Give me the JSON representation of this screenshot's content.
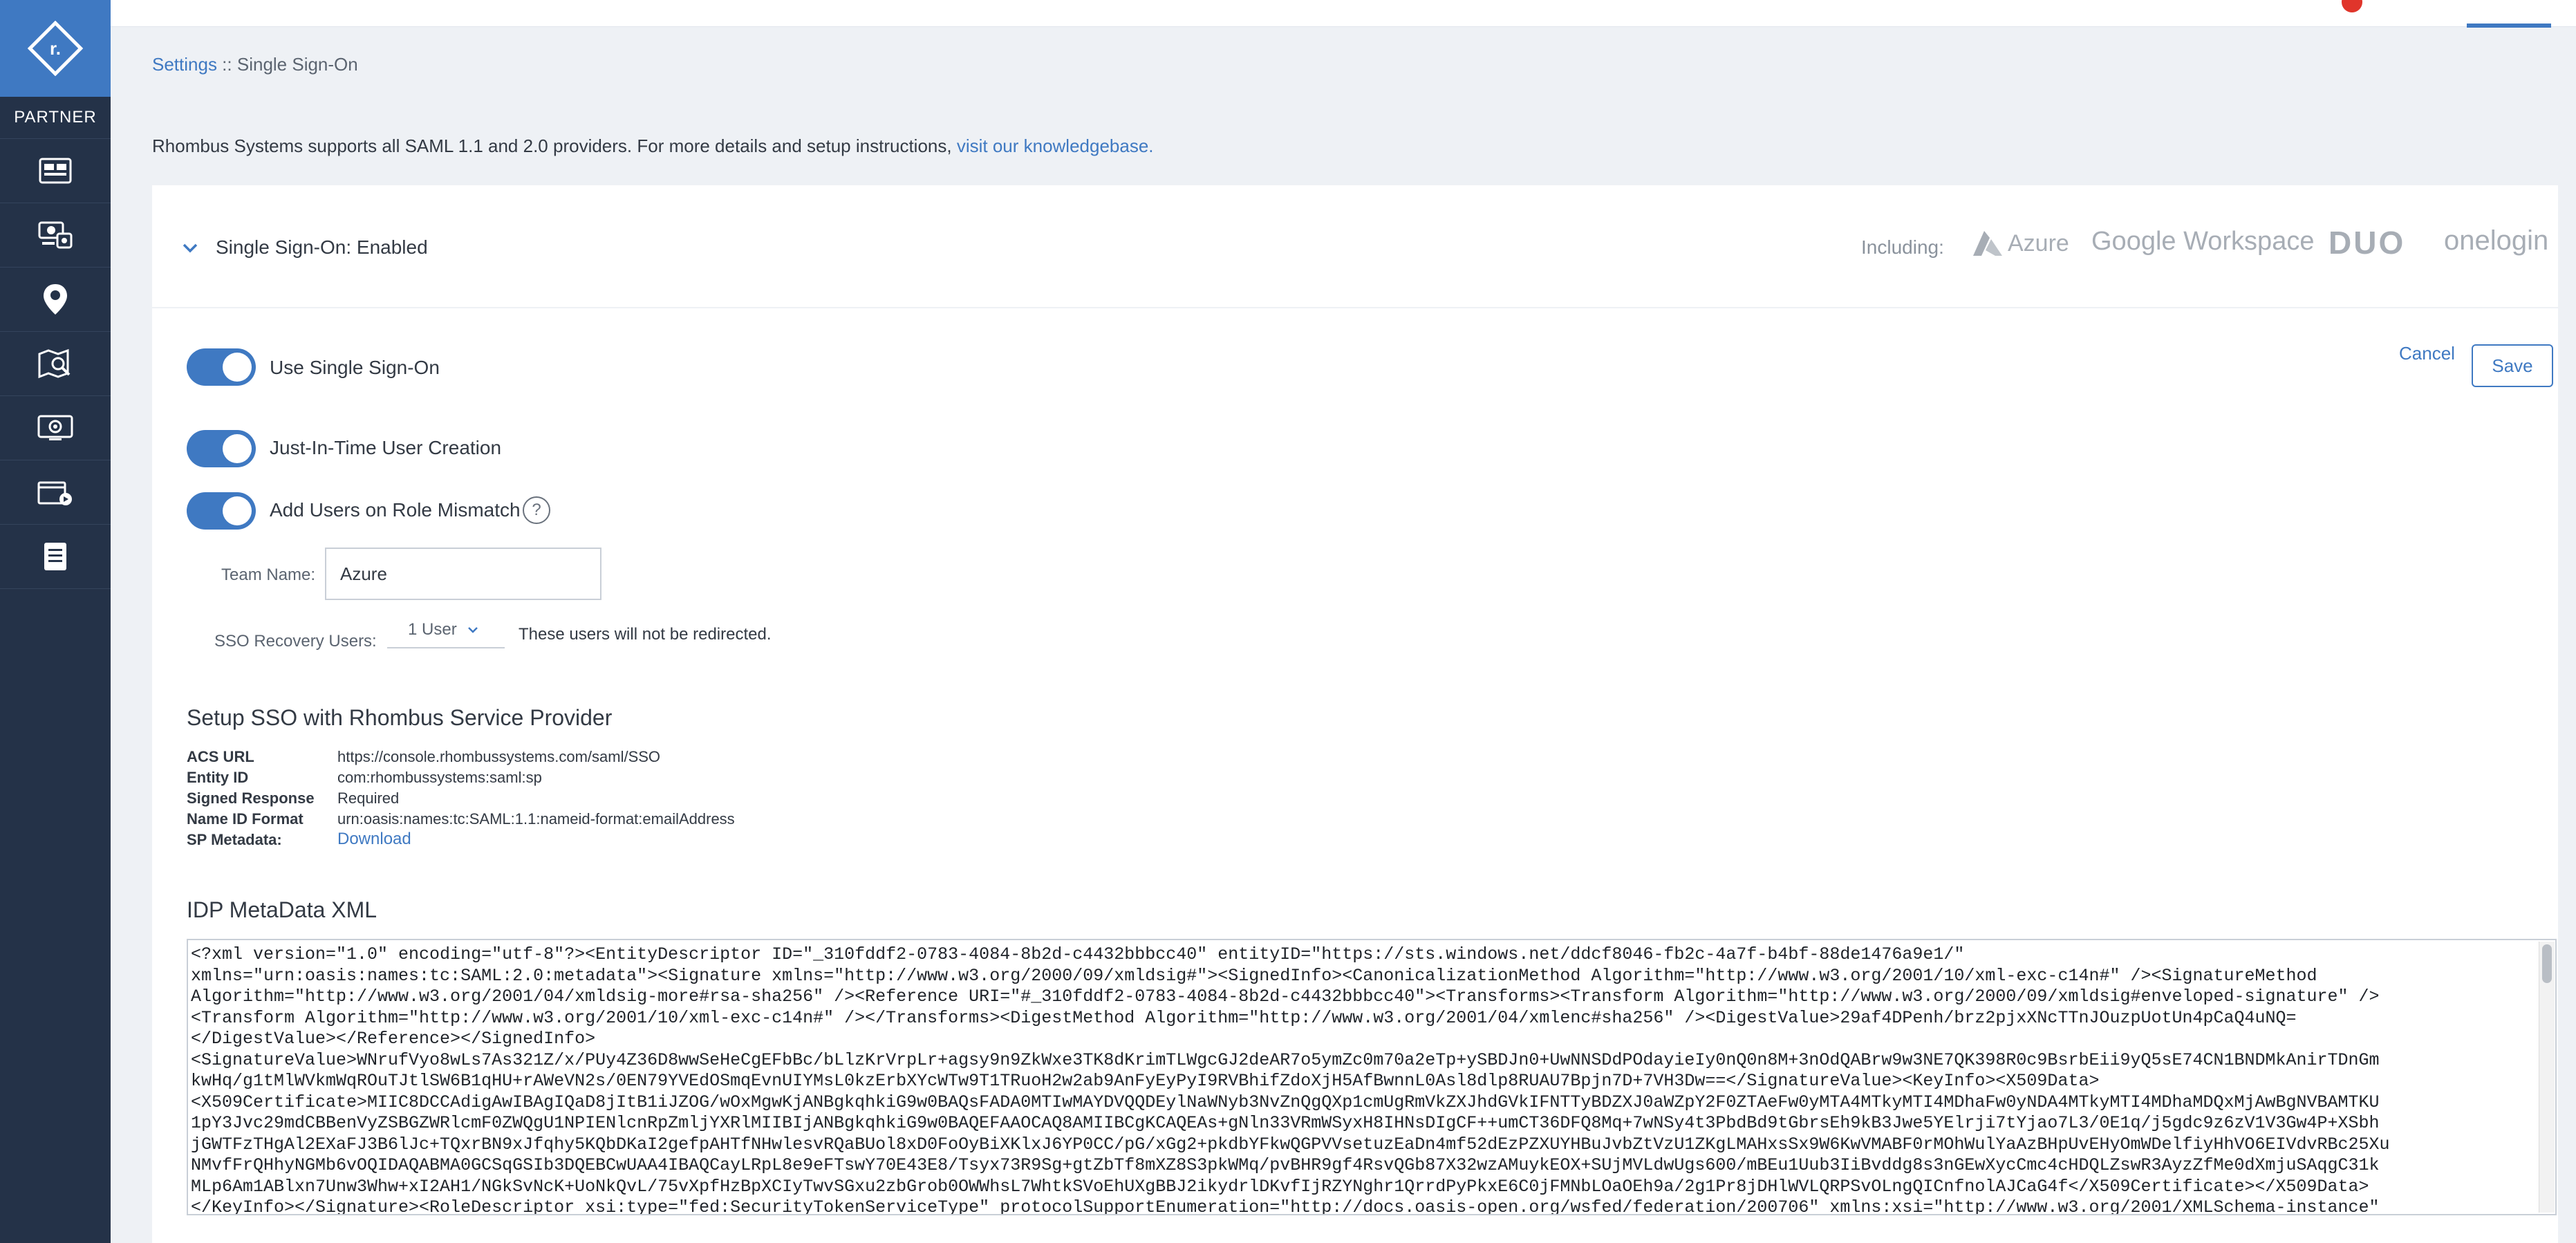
{
  "sidebar": {
    "logo_letter": "r.",
    "partner_label": "PARTNER",
    "nav_icons": [
      "dashboard-icon",
      "devices-icon",
      "location-pin-icon",
      "map-search-icon",
      "camera-device-icon",
      "video-clips-icon",
      "reports-icon"
    ]
  },
  "breadcrumb": {
    "root": "Settings",
    "separator": " :: ",
    "current": "Single Sign-On"
  },
  "intro": {
    "text": "Rhombus Systems supports all SAML 1.1 and 2.0 providers. For more details and setup instructions, ",
    "link": "visit our knowledgebase."
  },
  "sso_panel": {
    "title": "Single Sign-On: Enabled",
    "including_label": "Including:",
    "providers": [
      "Azure",
      "Google Workspace",
      "DUO",
      "onelogin"
    ]
  },
  "toggles": {
    "use_sso": "Use Single Sign-On",
    "jit": "Just-In-Time User Creation",
    "role_mismatch": "Add Users on Role Mismatch",
    "help_glyph": "?"
  },
  "actions": {
    "cancel": "Cancel",
    "save": "Save"
  },
  "team": {
    "label": "Team Name:",
    "value": "Azure"
  },
  "recovery": {
    "label": "SSO Recovery Users:",
    "selected": "1 User",
    "note": "These users will not be redirected."
  },
  "service_provider": {
    "title": "Setup SSO with Rhombus Service Provider",
    "rows": [
      {
        "key": "ACS URL",
        "value": "https://console.rhombussystems.com/saml/SSO"
      },
      {
        "key": "Entity ID",
        "value": "com:rhombussystems:saml:sp"
      },
      {
        "key": "Signed Response",
        "value": "Required"
      },
      {
        "key": "Name ID Format",
        "value": "urn:oasis:names:tc:SAML:1.1:nameid-format:emailAddress"
      },
      {
        "key": "SP Metadata:",
        "value": "Download"
      }
    ]
  },
  "idp": {
    "title": "IDP MetaData XML",
    "xml": "<?xml version=\"1.0\" encoding=\"utf-8\"?><EntityDescriptor ID=\"_310fddf2-0783-4084-8b2d-c4432bbbcc40\" entityID=\"https://sts.windows.net/ddcf8046-fb2c-4a7f-b4bf-88de1476a9e1/\"\nxmlns=\"urn:oasis:names:tc:SAML:2.0:metadata\"><Signature xmlns=\"http://www.w3.org/2000/09/xmldsig#\"><SignedInfo><CanonicalizationMethod Algorithm=\"http://www.w3.org/2001/10/xml-exc-c14n#\" /><SignatureMethod\nAlgorithm=\"http://www.w3.org/2001/04/xmldsig-more#rsa-sha256\" /><Reference URI=\"#_310fddf2-0783-4084-8b2d-c4432bbbcc40\"><Transforms><Transform Algorithm=\"http://www.w3.org/2000/09/xmldsig#enveloped-signature\" />\n<Transform Algorithm=\"http://www.w3.org/2001/10/xml-exc-c14n#\" /></Transforms><DigestMethod Algorithm=\"http://www.w3.org/2001/04/xmlenc#sha256\" /><DigestValue>29af4DPenh/brz2pjxXNcTTnJOuzpUotUn4pCaQ4uNQ=\n</DigestValue></Reference></SignedInfo>\n<SignatureValue>WNrufVyo8wLs7As321Z/x/PUy4Z36D8wwSeHeCgEFbBc/bLlzKrVrpLr+agsy9n9ZkWxe3TK8dKrimTLWgcGJ2deAR7o5ymZc0m70a2eTp+ySBDJn0+UwNNSDdPOdayieIy0nQ0n8M+3nOdQABrw9w3NE7QK398R0c9BsrbEii9yQ5sE74CN1BNDMkAnirTDnGm\nkwHq/g1tMlWVkmWqROuTJtlSW6B1qHU+rAWeVN2s/0EN79YVEdOSmqEvnUIYMsL0kzErbXYcWTw9T1TRuoH2w2ab9AnFyEyPyI9RVBhifZdoXjH5AfBwnnL0Asl8dlp8RUAU7Bpjn7D+7VH3Dw==</SignatureValue><KeyInfo><X509Data>\n<X509Certificate>MIIC8DCCAdigAwIBAgIQaD8jItB1iJZOG/wOxMgwKjANBgkqhkiG9w0BAQsFADA0MTIwMAYDVQQDEylNaWNyb3NvZnQgQXp1cmUgRmVkZXJhdGVkIFNTTyBDZXJ0aWZpY2F0ZTAeFw0yMTA4MTkyMTI4MDhaFw0yNDA4MTkyMTI4MDhaMDQxMjAwBgNVBAMTKU\n1pY3Jvc29mdCBBenVyZSBGZWRlcmF0ZWQgU1NPIENlcnRpZmljYXRlMIIBIjANBgkqhkiG9w0BAQEFAAOCAQ8AMIIBCgKCAQEAs+gNln33VRmWSyxH8IHNsDIgCF++umCT36DFQ8Mq+7wNSy4t3PbdBd9tGbrsEh9kB3Jwe5YElrji7tYjao7L3/0E1q/j5gdc9z6zV1V3Gw4P+XSbh\njGWTFzTHgAl2EXaFJ3B6lJc+TQxrBN9xJfqhy5KQbDKaI2gefpAHTfNHwlesvRQaBUol8xD0FoOyBiXKlxJ6YP0CC/pG/xGg2+pkdbYFkwQGPVVsetuzEaDn4mf52dEzPZXUYHBuJvbZtVzU1ZKgLMAHxsSx9W6KwVMABF0rMOhWulYaAzBHpUvEHyOmWDelfiyHhVO6EIVdvRBc25Xu\nNMvfFrQHhyNGMb6vOQIDAQABMA0GCSqGSIb3DQEBCwUAA4IBAQCayLRpL8e9eFTswY70E43E8/Tsyx73R9Sg+gtZbTf8mXZ8S3pkWMq/pvBHR9gf4RsvQGb87X32wzAMuykEOX+SUjMVLdwUgs600/mBEu1Uub3IiBvddg8s3nGEwXycCmc4cHDQLZswR3AyzZfMe0dXmjuSAqgC31k\nMLp6Am1ABlxn7Unw3Whw+xI2AH1/NGkSvNcK+UoNkQvL/75vXpfHzBpXCIyTwvSGxu2zbGrob0OWWhsL7WhtkSVoEhUXgBBJ2ikydrlDKvfIjRZYNghr1QrrdPyPkxE6C0jFMNbLOaOEh9a/2g1Pr8jDHlWVLQRPSvOLngQICnfnolAJCaG4f</X509Certificate></X509Data>\n</KeyInfo></Signature><RoleDescriptor xsi:type=\"fed:SecurityTokenServiceType\" protocolSupportEnumeration=\"http://docs.oasis-open.org/wsfed/federation/200706\" xmlns:xsi=\"http://www.w3.org/2001/XMLSchema-instance\""
  },
  "colors": {
    "accent": "#3f79c2",
    "sidebar": "#243248",
    "page_bg": "#eef1f5"
  }
}
